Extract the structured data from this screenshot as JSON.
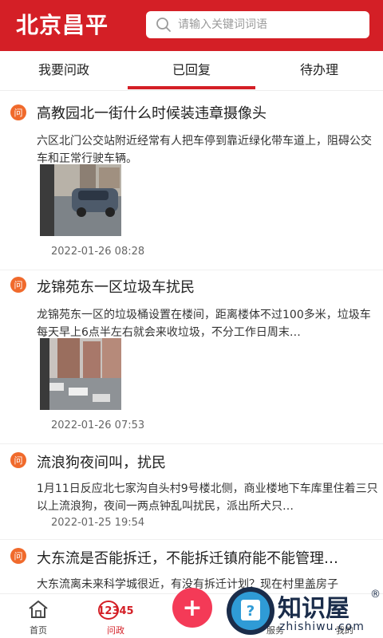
{
  "header": {
    "logo_text": "北京昌平",
    "search_placeholder": "请输入关键词词语",
    "bg_color": "#d41f26"
  },
  "tabs": [
    {
      "label": "我要问政",
      "active": false
    },
    {
      "label": "已回复",
      "active": true
    },
    {
      "label": "待办理",
      "active": false
    }
  ],
  "items": [
    {
      "badge": "问",
      "title": "高教园北一街什么时候装违章摄像头",
      "desc": "六区北门公交站附近经常有人把车停到靠近绿化带车道上，阻碍公交车和正常行驶车辆。",
      "date": "2022-01-26 08:28",
      "has_image": true
    },
    {
      "badge": "问",
      "title": "龙锦苑东一区垃圾车扰民",
      "desc": "龙锦苑东一区的垃圾桶设置在楼间，距离楼体不过100多米，垃圾车每天早上6点半左右就会来收垃圾，不分工作日周末…",
      "date": "2022-01-26 07:53",
      "has_image": true
    },
    {
      "badge": "问",
      "title": "流浪狗夜间叫，扰民",
      "desc": "1月11日反应北七家沟自头村9号楼北侧，商业楼地下车库里住着三只以上流浪狗，夜间一两点钟乱叫扰民，派出所犬只…",
      "date": "2022-01-25 19:54",
      "has_image": false
    },
    {
      "badge": "问",
      "title": "大东流是否能拆迁，不能拆迁镇府能不能管理…",
      "desc": "大东流离未来科学城很近，有没有拆迁计划？现在村里盖房子",
      "date": "",
      "has_image": false
    }
  ],
  "bottom_nav": {
    "home_label": "首页",
    "wenzheng_label": "问政",
    "wenzheng_badge": "12345",
    "add_symbol": "+",
    "fuwu_label": "服务",
    "me_label": "我的"
  },
  "watermark": {
    "text": "知识屋",
    "sub": "zhishiwu.com",
    "q_symbol": "?",
    "reg": "®"
  }
}
